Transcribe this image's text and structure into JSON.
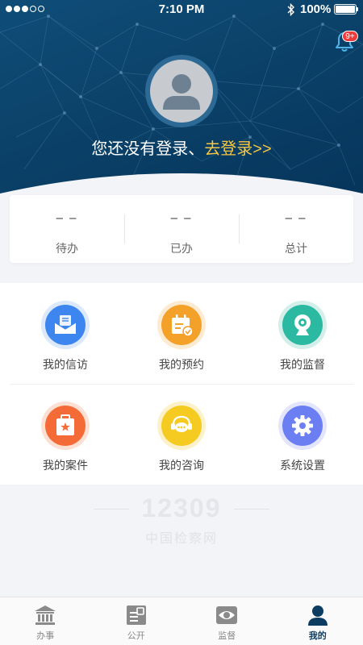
{
  "status_bar": {
    "time": "7:10 PM",
    "battery": "100%",
    "battery_level": 1.0,
    "signal_bars": 5,
    "signal_filled": 3
  },
  "notifications": {
    "badge": "9+",
    "icon": "bell-icon"
  },
  "profile": {
    "avatar_icon": "user-avatar-icon",
    "prompt": "您还没有登录、",
    "login_link": "去登录>>"
  },
  "stats": [
    {
      "value": "– –",
      "label": "待办"
    },
    {
      "value": "– –",
      "label": "已办"
    },
    {
      "value": "– –",
      "label": "总计"
    }
  ],
  "menu": [
    {
      "name": "my-petition",
      "label": "我的信访",
      "icon": "mail-icon",
      "color": "#3d86f0",
      "ring": "#dbe9fb"
    },
    {
      "name": "my-appointment",
      "label": "我的预约",
      "icon": "calendar-icon",
      "color": "#f4a12a",
      "ring": "#fcebd0"
    },
    {
      "name": "my-supervision",
      "label": "我的监督",
      "icon": "webcam-icon",
      "color": "#2bb9a2",
      "ring": "#d4efea"
    },
    {
      "name": "my-case",
      "label": "我的案件",
      "icon": "case-briefcase-icon",
      "color": "#f56b37",
      "ring": "#fde0d4"
    },
    {
      "name": "my-consultation",
      "label": "我的咨询",
      "icon": "chat-bubble-icon",
      "color": "#f6cb21",
      "ring": "#fcf1c8"
    },
    {
      "name": "system-settings",
      "label": "系统设置",
      "icon": "gear-icon",
      "color": "#6c7ff2",
      "ring": "#e2e5fb"
    }
  ],
  "watermark": {
    "number": "12309",
    "text": "中国检察网"
  },
  "tabbar": [
    {
      "name": "handle",
      "label": "办事",
      "icon": "government-building-icon",
      "active": false
    },
    {
      "name": "public",
      "label": "公开",
      "icon": "public-notice-icon",
      "active": false
    },
    {
      "name": "supervise",
      "label": "监督",
      "icon": "eye-icon",
      "active": false
    },
    {
      "name": "mine",
      "label": "我的",
      "icon": "person-icon",
      "active": true
    }
  ],
  "colors": {
    "header": "#0f4d78",
    "accent": "#f6c744",
    "active_tab": "#0d3c61",
    "badge": "#ee3b3b"
  }
}
